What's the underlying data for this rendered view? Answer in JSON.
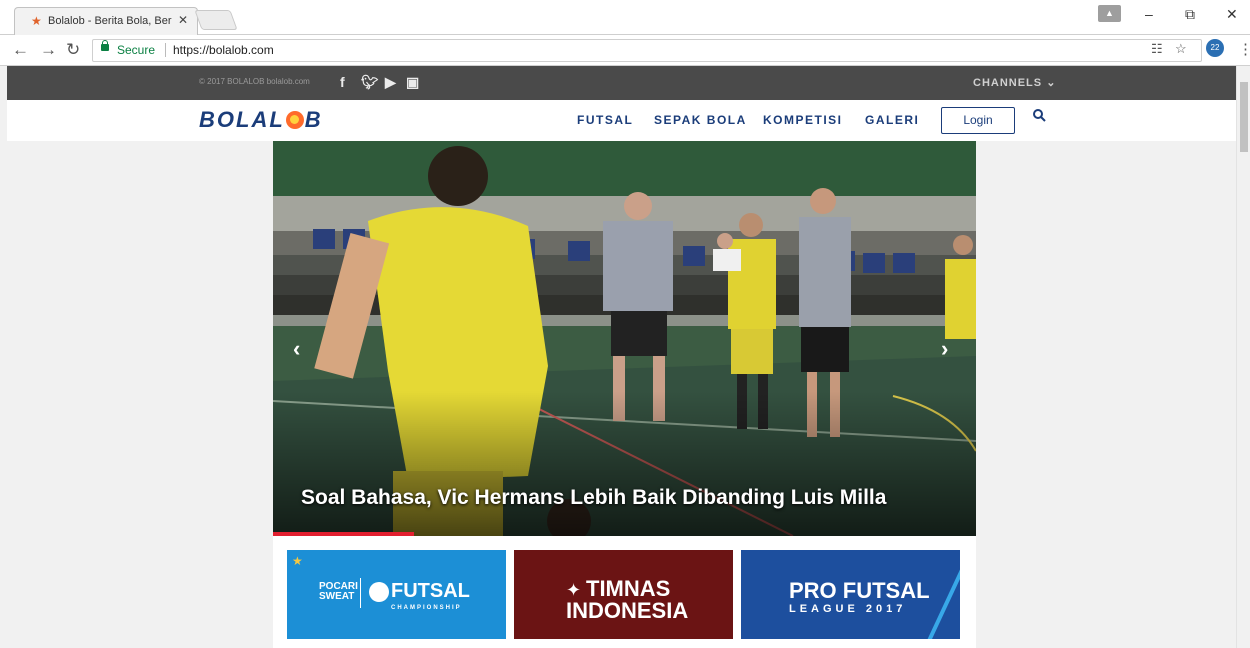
{
  "browser": {
    "tab_title": "Bolalob - Berita Bola, Ber",
    "secure_label": "Secure",
    "url": "https://bolalob.com"
  },
  "site": {
    "copyright": "© 2017 BOLALOB bolalob.com",
    "channels_label": "CHANNELS",
    "logo_text": "BOLAL",
    "logo_text_end": "B",
    "nav": [
      "FUTSAL",
      "SEPAK BOLA",
      "KOMPETISI",
      "GALERI"
    ],
    "login_label": "Login"
  },
  "hero": {
    "headline": "Soal Bahasa, Vic Hermans Lebih Baik Dibanding Luis Milla",
    "progress": 0.2
  },
  "thumbnails": [
    {
      "line1": "POCARI SWEAT",
      "line2": "FUTSAL",
      "line3": "CHAMPIONSHIP"
    },
    {
      "line1": "TIMNAS",
      "line2": "INDONESIA"
    },
    {
      "line1": "PRO FUTSAL",
      "line2": "LEAGUE 2017"
    }
  ],
  "colors": {
    "brand_navy": "#1b3d7a",
    "topbar": "#4a4a4a",
    "accent_red": "#e21f2f"
  }
}
